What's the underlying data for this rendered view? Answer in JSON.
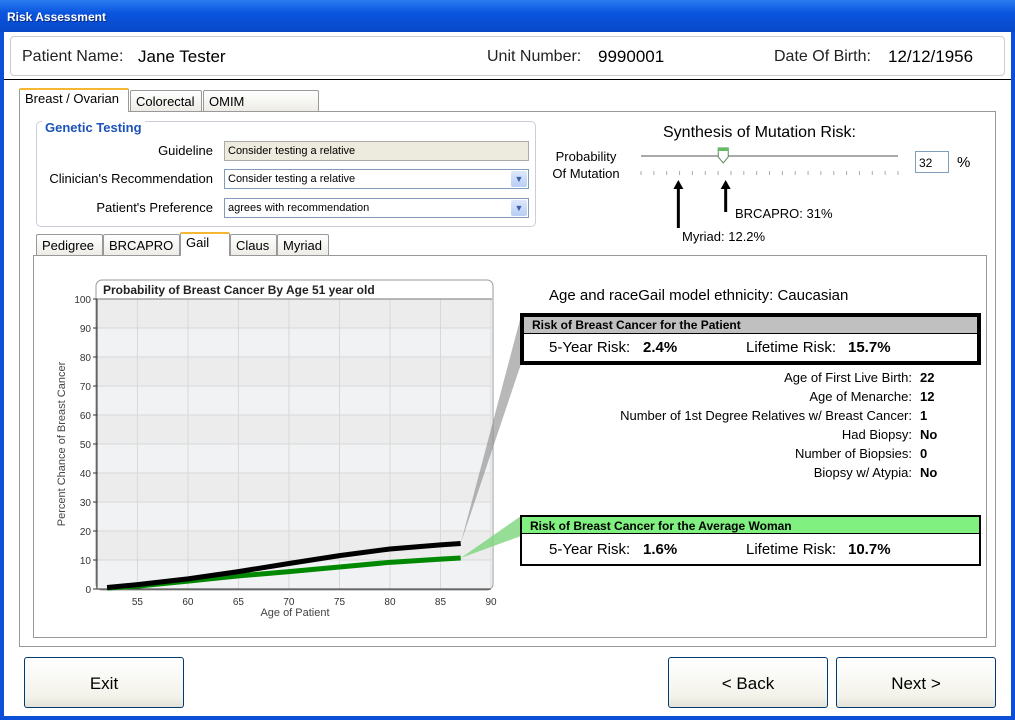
{
  "window": {
    "title": "Risk Assessment"
  },
  "patient": {
    "name_label": "Patient Name:",
    "name": "Jane Tester",
    "unit_label": "Unit Number:",
    "unit": "9990001",
    "dob_label": "Date Of Birth:",
    "dob": "12/12/1956"
  },
  "main_tabs": [
    {
      "label": "Breast / Ovarian",
      "active": true
    },
    {
      "label": "Colorectal"
    },
    {
      "label": "OMIM Syndromes"
    }
  ],
  "genetic_testing": {
    "title": "Genetic Testing",
    "guideline_label": "Guideline",
    "guideline": "Consider testing a relative",
    "clinician_label": "Clinician's Recommendation",
    "clinician": "Consider testing a relative",
    "preference_label": "Patient's Preference",
    "preference": "agrees with recommendation"
  },
  "synthesis": {
    "title": "Synthesis of Mutation Risk:",
    "prob_label_1": "Probability",
    "prob_label_2": "Of Mutation",
    "value": "32",
    "value_percent": 32,
    "unit": "%",
    "brcapro_label": "BRCAPRO: 31%",
    "brcapro_percent": 31,
    "myriad_label": "Myriad: 12.2%",
    "myriad_percent": 12.2
  },
  "sub_tabs": [
    {
      "label": "Pedigree"
    },
    {
      "label": "BRCAPRO"
    },
    {
      "label": "Gail",
      "active": true
    },
    {
      "label": "Claus"
    },
    {
      "label": "Myriad"
    }
  ],
  "gail": {
    "ethnicity": "Age and raceGail model ethnicity: Caucasian",
    "patient_box": {
      "title": "Risk of Breast Cancer for the Patient",
      "five_label": "5-Year Risk:",
      "five": "2.4%",
      "life_label": "Lifetime Risk:",
      "life": "15.7%"
    },
    "average_box": {
      "title": "Risk of Breast Cancer for the Average Woman",
      "five_label": "5-Year Risk:",
      "five": "1.6%",
      "life_label": "Lifetime Risk:",
      "life": "10.7%"
    },
    "factors": [
      {
        "label": "Age of First Live Birth:",
        "value": "22"
      },
      {
        "label": "Age of Menarche:",
        "value": "12"
      },
      {
        "label": "Number of 1st Degree Relatives w/ Breast Cancer:",
        "value": "1"
      },
      {
        "label": "Had Biopsy:",
        "value": "No"
      },
      {
        "label": "Number of Biopsies:",
        "value": "0"
      },
      {
        "label": "Biopsy w/ Atypia:",
        "value": "No"
      }
    ],
    "colors": {
      "patient": "#000000",
      "average": "#008800",
      "average_header": "#80f080",
      "patient_header": "#c0c0c0"
    }
  },
  "chart_data": {
    "type": "line",
    "title": "Probability of Breast Cancer By Age 51 year old",
    "xlabel": "Age of Patient",
    "ylabel": "Percent Chance of Breast Cancer",
    "xlim": [
      51,
      90
    ],
    "ylim": [
      0,
      100
    ],
    "xticks": [
      55,
      60,
      65,
      70,
      75,
      80,
      85,
      90
    ],
    "yticks": [
      0,
      10,
      20,
      30,
      40,
      50,
      60,
      70,
      80,
      90,
      100
    ],
    "grid": true,
    "x": [
      52,
      55,
      60,
      65,
      70,
      75,
      80,
      85,
      87
    ],
    "series": [
      {
        "color": "#000000",
        "values": [
          0.5,
          1.5,
          3.5,
          6,
          8.8,
          11.5,
          13.8,
          15.2,
          15.7
        ]
      },
      {
        "color": "#008800",
        "values": [
          0.3,
          1,
          2.7,
          4.5,
          6,
          7.6,
          9.2,
          10.3,
          10.7
        ]
      }
    ]
  },
  "buttons": {
    "exit": "Exit",
    "back": "< Back",
    "next": "Next >"
  }
}
